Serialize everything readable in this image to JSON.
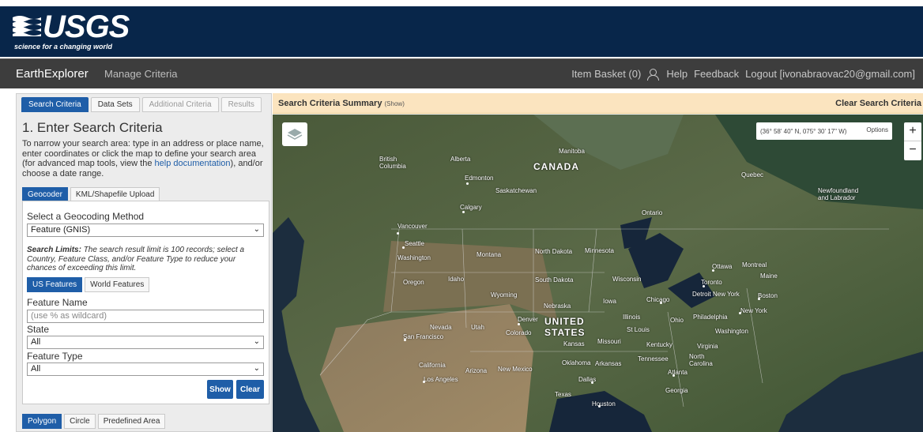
{
  "header": {
    "logo_text": "USGS",
    "tagline": "science for a changing world"
  },
  "nav": {
    "app_name": "EarthExplorer",
    "manage": "Manage Criteria",
    "item_basket": "Item Basket (0)",
    "help": "Help",
    "feedback": "Feedback",
    "logout": "Logout [ivonabraovac20@gmail.com]"
  },
  "tabs": [
    "Search Criteria",
    "Data Sets",
    "Additional Criteria",
    "Results"
  ],
  "search": {
    "title": "1. Enter Search Criteria",
    "intro_1": "To narrow your search area: type in an address or place name, enter coordinates or click the map to define your search area (for advanced map tools, view the ",
    "intro_link": "help documentation",
    "intro_2": "), and/or choose a date range.",
    "subtabs": [
      "Geocoder",
      "KML/Shapefile Upload"
    ],
    "method_label": "Select a Geocoding Method",
    "method_value": "Feature (GNIS)",
    "limits_bold": "Search Limits:",
    "limits_text": " The search result limit is 100 records; select a Country, Feature Class, and/or Feature Type to reduce your chances of exceeding this limit.",
    "feature_tabs": [
      "US Features",
      "World Features"
    ],
    "feature_name_label": "Feature Name",
    "feature_name_placeholder": "(use % as wildcard)",
    "state_label": "State",
    "state_value": "All",
    "type_label": "Feature Type",
    "type_value": "All",
    "show_label": "Show",
    "clear_label": "Clear",
    "area_tabs": [
      "Polygon",
      "Circle",
      "Predefined Area"
    ]
  },
  "summary": {
    "title": "Search Criteria Summary",
    "show": "(Show)",
    "clear": "Clear Search Criteria"
  },
  "map": {
    "coords": "(36° 58' 40\" N, 075° 30' 17\" W)",
    "options": "Options",
    "zoom_in": "+",
    "zoom_out": "−",
    "labels": {
      "british_columbia": "British Columbia",
      "alberta": "Alberta",
      "manitoba": "Manitoba",
      "canada": "CANADA",
      "edmonton": "Edmonton",
      "saskatchewan": "Saskatchewan",
      "quebec": "Quebec",
      "newfoundland": "Newfoundland and Labrador",
      "calgary": "Calgary",
      "ontario": "Ontario",
      "vancouver": "Vancouver",
      "seattle": "Seattle",
      "washington": "Washington",
      "montana": "Montana",
      "north_dakota": "North Dakota",
      "minnesota": "Minnesota",
      "ottawa": "Ottawa",
      "montreal": "Montreal",
      "maine": "Maine",
      "oregon": "Oregon",
      "idaho": "Idaho",
      "south_dakota": "South Dakota",
      "wisconsin": "Wisconsin",
      "toronto": "Toronto",
      "wyoming": "Wyoming",
      "detroit": "Detroit",
      "new_york": "New York",
      "boston": "Boston",
      "iowa": "Iowa",
      "chicago": "Chicago",
      "nebraska": "Nebraska",
      "new_york_city": "New York",
      "denver": "Denver",
      "united": "UNITED",
      "states": "STATES",
      "illinois": "Illinois",
      "ohio": "Ohio",
      "philadelphia": "Philadelphia",
      "nevada": "Nevada",
      "utah": "Utah",
      "colorado": "Colorado",
      "st_louis": "St Louis",
      "washington_dc": "Washington",
      "san_francisco": "San Francisco",
      "kansas": "Kansas",
      "missouri": "Missouri",
      "kentucky": "Kentucky",
      "virginia": "Virginia",
      "tennessee": "Tennessee",
      "north_carolina": "North Carolina",
      "california": "California",
      "oklahoma": "Oklahoma",
      "arkansas": "Arkansas",
      "atlanta": "Atlanta",
      "arizona": "Arizona",
      "new_mexico": "New Mexico",
      "los_angeles": "Los Angeles",
      "dallas": "Dallas",
      "georgia": "Georgia",
      "texas": "Texas",
      "houston": "Houston"
    }
  },
  "colors": {
    "header_bg": "#08264a",
    "nav_bg": "#3d3d3d",
    "accent": "#1f5ea8",
    "summary_bg": "#fbe4bf"
  }
}
